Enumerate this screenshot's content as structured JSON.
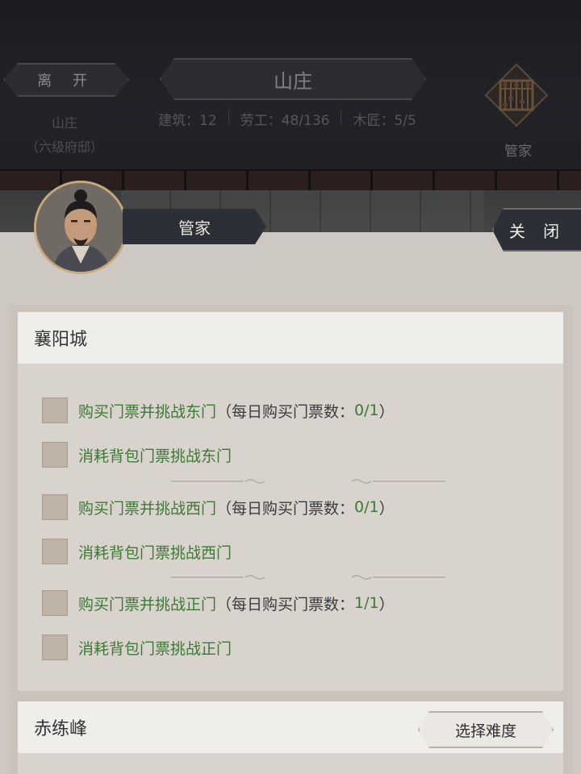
{
  "header": {
    "leave_label": "离 开",
    "title": "山庄",
    "stats": [
      {
        "label": "建筑：",
        "value": "12"
      },
      {
        "label": "劳工：",
        "value": "48/136"
      },
      {
        "label": "木匠：",
        "value": "5/5"
      }
    ],
    "fief_name": "山庄",
    "fief_rank": "（六级府邸）",
    "steward_label": "管家"
  },
  "dialog": {
    "npc_name": "管家",
    "close_label": "关 闭"
  },
  "sections": [
    {
      "title": "襄阳城",
      "options": [
        {
          "text": "购买门票并挑战东门",
          "prefix": "（每日购买门票数：",
          "count": "0/1",
          "suffix": "）"
        },
        {
          "text": "消耗背包门票挑战东门"
        },
        {
          "text": "购买门票并挑战西门",
          "prefix": "（每日购买门票数：",
          "count": "0/1",
          "suffix": "）"
        },
        {
          "text": "消耗背包门票挑战西门"
        },
        {
          "text": "购买门票并挑战正门",
          "prefix": "（每日购买门票数：",
          "count": "1/1",
          "suffix": "）"
        },
        {
          "text": "消耗背包门票挑战正门"
        }
      ]
    },
    {
      "title": "赤练峰",
      "button_label": "选择难度"
    }
  ],
  "colors": {
    "option_green": "#3c7a34",
    "panel": "#cdc8c1",
    "header_bg": "#1d1e21"
  }
}
